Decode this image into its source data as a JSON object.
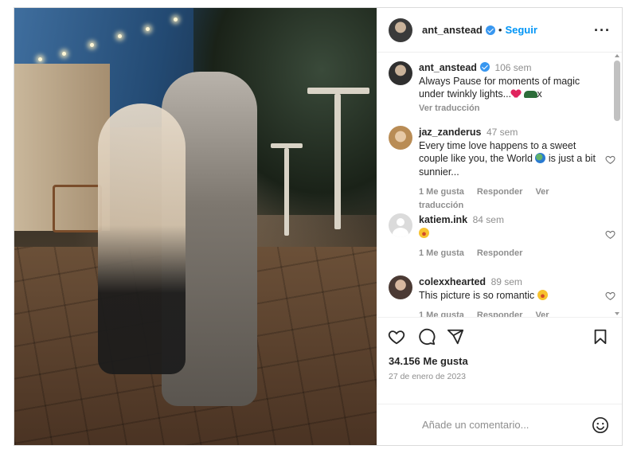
{
  "post": {
    "username": "ant_anstead",
    "separator": "•",
    "follow_label": "Seguir",
    "more_label": "···"
  },
  "caption": {
    "username": "ant_anstead",
    "time": "106 sem",
    "text": "Always Pause for moments of magic under twinkly lights...",
    "trailing": "x",
    "see_translation": "Ver traducción"
  },
  "comments": [
    {
      "username": "jaz_zanderus",
      "time": "47 sem",
      "text_before": "Every time love happens to a sweet couple like you, the World",
      "text_after": "is just a bit sunnier...",
      "likes": "1 Me gusta",
      "reply": "Responder",
      "translate": "Ver traducción"
    },
    {
      "username": "katiem.ink",
      "time": "84 sem",
      "likes": "1 Me gusta",
      "reply": "Responder"
    },
    {
      "username": "colexxhearted",
      "time": "89 sem",
      "text": "This picture is so romantic",
      "likes": "1 Me gusta",
      "reply": "Responder",
      "translate": "Ver traducción"
    }
  ],
  "stats": {
    "likes": "34.156 Me gusta",
    "date": "27 de enero de 2023"
  },
  "composer": {
    "placeholder": "Añade un comentario..."
  },
  "icons": {
    "like": "heart-icon",
    "comment": "comment-icon",
    "share": "share-icon",
    "save": "bookmark-icon",
    "emoji": "smiley-icon",
    "verified": "verified-badge-icon"
  },
  "colors": {
    "accent": "#0095f6",
    "verified": "#3897f0",
    "muted": "#8e8e8e",
    "text": "#262626"
  }
}
